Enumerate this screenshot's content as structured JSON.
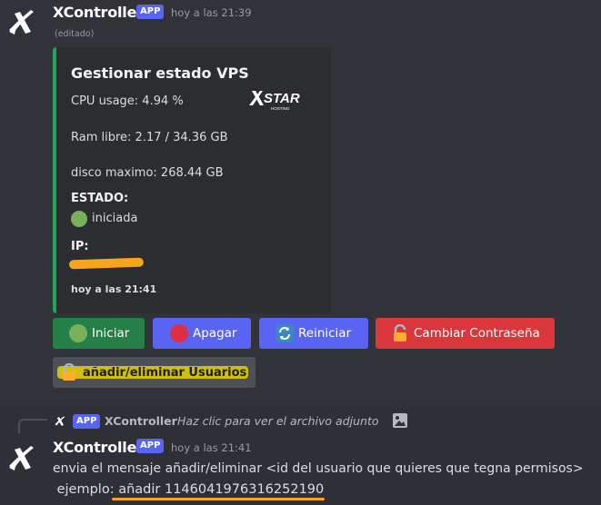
{
  "message1": {
    "author": "XController",
    "app_tag": "APP",
    "timestamp": "hoy a las 21:39",
    "edited": "(editado)",
    "embed": {
      "title": "Gestionar estado VPS",
      "cpu": "CPU usage: 4.94 %",
      "ram": "Ram libre: 2.17 / 34.36 GB",
      "disk": "disco maximo: 268.44 GB",
      "estado_label": "ESTADO:",
      "estado_value": "iniciada",
      "ip_label": "IP:",
      "footer": "hoy a las 21:41",
      "accent_color": "#23a559",
      "logo_text": "STAR",
      "logo_sub": "HOSTING"
    },
    "buttons": {
      "iniciar": "Iniciar",
      "apagar": "Apagar",
      "reiniciar": "Reiniciar",
      "cambiar": "Cambiar Contraseña",
      "usuarios": "añadir/eliminar Usuarios"
    }
  },
  "message2": {
    "reply": {
      "app_tag": "APP",
      "author": "XController",
      "text": "Haz clic para ver el archivo adjunto"
    },
    "author": "XController",
    "app_tag": "APP",
    "timestamp": "hoy a las 21:41",
    "line1": "envia el mensaje añadir/eliminar <id del usuario que quieres que tegna permisos>",
    "line2_prefix": " ejemplo: ",
    "line2_example": "añadir 1146041976316252190"
  },
  "icons": [
    "x-logo-icon",
    "green-circle-icon",
    "red-circle-icon",
    "refresh-icon",
    "lock-icon",
    "image-icon"
  ]
}
